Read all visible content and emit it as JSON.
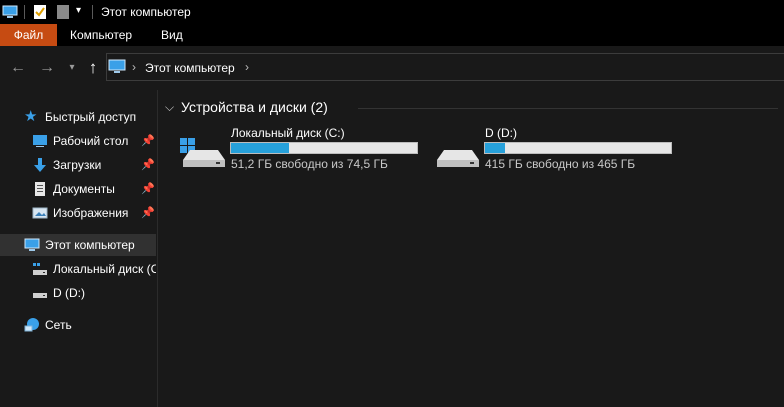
{
  "window": {
    "title": "Этот компьютер"
  },
  "ribbon": {
    "tabs": [
      "Файл",
      "Компьютер",
      "Вид"
    ],
    "accent": "#c64b12"
  },
  "address": {
    "crumb": "Этот компьютер"
  },
  "sidebar": {
    "quick_access": "Быстрый доступ",
    "items": [
      {
        "label": "Рабочий стол",
        "icon": "desktop-icon",
        "pinned": true
      },
      {
        "label": "Загрузки",
        "icon": "download-icon",
        "pinned": true
      },
      {
        "label": "Документы",
        "icon": "document-icon",
        "pinned": true
      },
      {
        "label": "Изображения",
        "icon": "pictures-icon",
        "pinned": true
      }
    ],
    "this_pc": "Этот компьютер",
    "drives": [
      "Локальный диск (C:)",
      "D (D:)"
    ],
    "network": "Сеть"
  },
  "section": {
    "title": "Устройства и диски (2)"
  },
  "drives": [
    {
      "name": "Локальный диск (C:)",
      "free_text": "51,2 ГБ свободно из 74,5 ГБ",
      "used_fraction": 0.313
    },
    {
      "name": "D (D:)",
      "free_text": "415 ГБ свободно из 465 ГБ",
      "used_fraction": 0.108
    }
  ],
  "colors": {
    "usage_bar": "#26a0da",
    "background": "#191919"
  }
}
